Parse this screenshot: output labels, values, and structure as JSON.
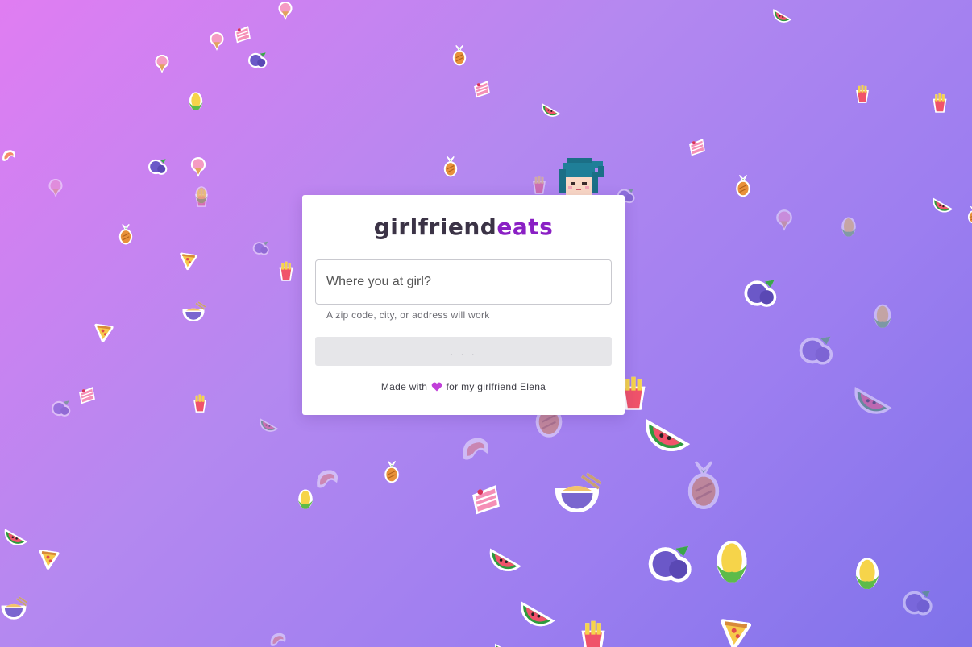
{
  "app": {
    "logo_part1": "girlfriend",
    "logo_part2": "eats",
    "brand_color": "#8a1fc4",
    "text_dark": "#3b3346"
  },
  "search": {
    "placeholder": "Where you at girl?",
    "value": "",
    "helper": "A zip code, city, or address will work",
    "submit_label": ". . ."
  },
  "footer": {
    "prefix": "Made with",
    "heart_icon": "purple-heart-icon",
    "suffix": "for my girlfriend Elena"
  },
  "background": {
    "gradient": [
      "#e07df2",
      "#b488f0",
      "#9d7ef0",
      "#7f72ea"
    ],
    "sticker_icons": [
      "watermelon-icon",
      "pineapple-icon",
      "corn-icon",
      "blueberry-icon",
      "pizza-icon",
      "ice-cream-icon",
      "cake-icon",
      "fries-icon",
      "bowl-icon",
      "shrimp-icon"
    ]
  },
  "mascot": {
    "icon": "pixel-girl-icon"
  }
}
